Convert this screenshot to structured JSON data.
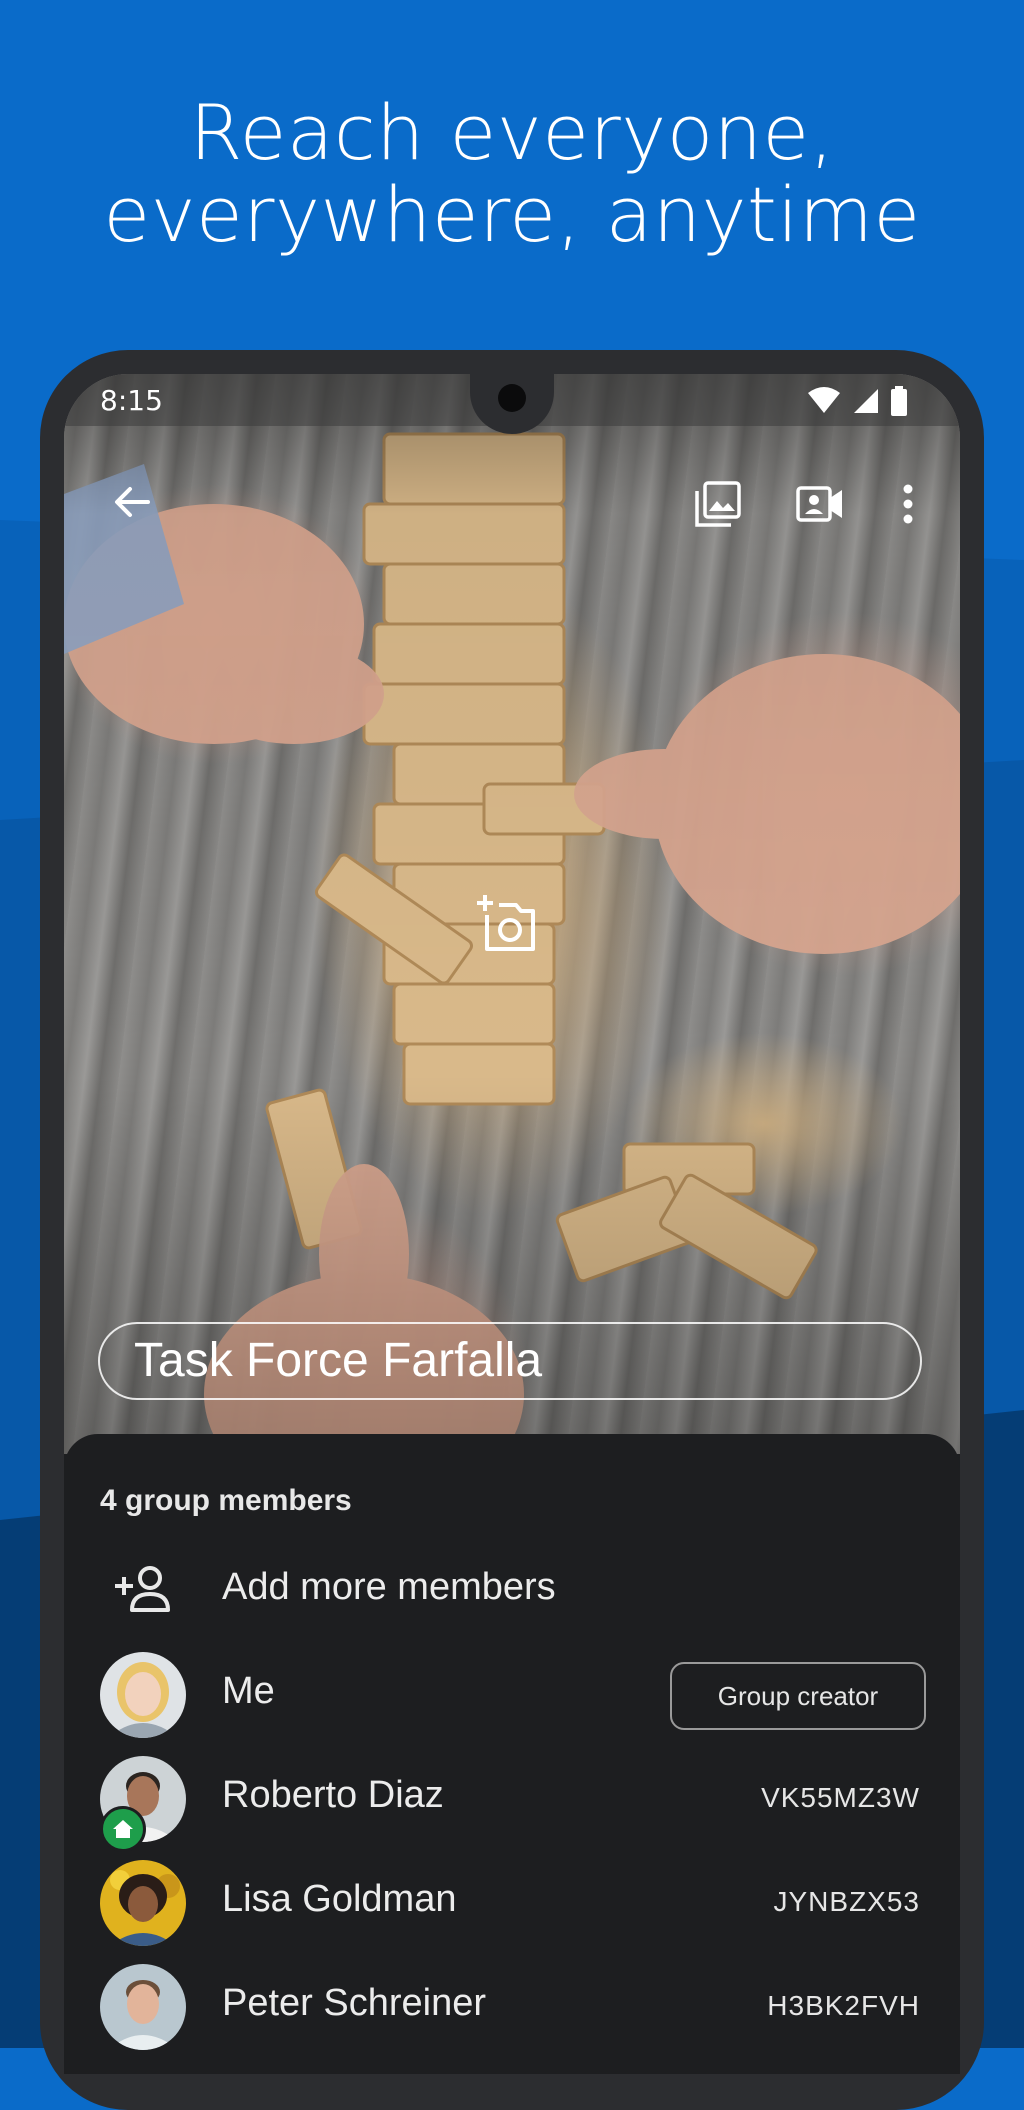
{
  "headline": {
    "line1": "Reach everyone,",
    "line2": "everywhere, anytime"
  },
  "colors": {
    "background": "#0a6bc9",
    "panel": "#1d1e20",
    "phone_frame": "#2c2d30",
    "home_badge": "#1e9e4b"
  },
  "status_bar": {
    "time": "8:15",
    "icons": [
      "wifi-icon",
      "signal-icon",
      "battery-icon"
    ]
  },
  "app_bar": {
    "icons": [
      "back-arrow-icon",
      "gallery-icon",
      "video-call-icon",
      "more-vert-icon"
    ]
  },
  "group": {
    "name": "Task Force Farfalla",
    "photo_action_icon": "add-photo-icon"
  },
  "members": {
    "count_label": "4 group members",
    "add_label": "Add more members",
    "add_icon": "add-person-icon",
    "list": [
      {
        "name": "Me",
        "badge": "Group creator"
      },
      {
        "name": "Roberto Diaz",
        "code": "VK55MZ3W",
        "status_icon": "home-icon"
      },
      {
        "name": "Lisa Goldman",
        "code": "JYNBZX53"
      },
      {
        "name": "Peter Schreiner",
        "code": "H3BK2FVH"
      }
    ]
  }
}
